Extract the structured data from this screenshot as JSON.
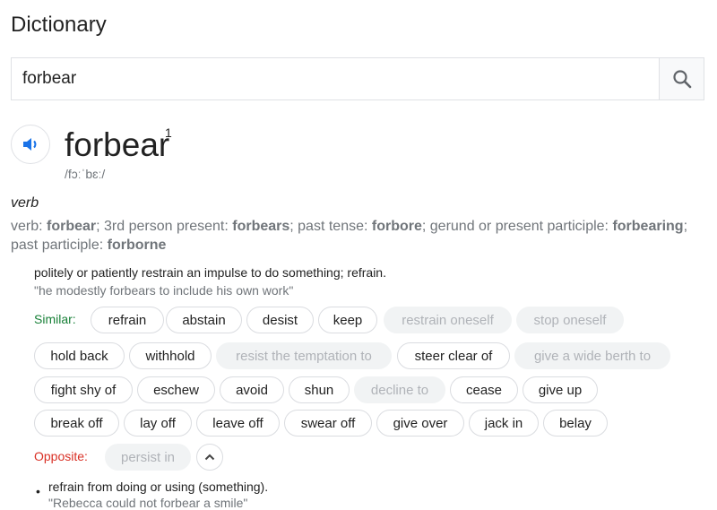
{
  "header": {
    "title": "Dictionary"
  },
  "search": {
    "value": "forbear",
    "placeholder": ""
  },
  "entry": {
    "word": "forbear",
    "superscript": "1",
    "phonetic": "/fɔːˈbɛː/",
    "part_of_speech": "verb",
    "forms": {
      "verb_label": "verb: ",
      "verb": "forbear",
      "p3_label": "; 3rd person present: ",
      "p3": "forbears",
      "past_label": "; past tense: ",
      "past": "forbore",
      "gerund_label": "; gerund or present participle: ",
      "gerund": "forbearing",
      "pp_label": "; past participle: ",
      "pp": "forborne"
    },
    "sense1": {
      "definition": "politely or patiently restrain an impulse to do something; refrain.",
      "example": "\"he modestly forbears to include his own work\"",
      "similar_label": "Similar:",
      "similar": [
        {
          "text": "refrain",
          "enabled": true
        },
        {
          "text": "abstain",
          "enabled": true
        },
        {
          "text": "desist",
          "enabled": true
        },
        {
          "text": "keep",
          "enabled": true
        },
        {
          "text": "restrain oneself",
          "enabled": false
        },
        {
          "text": "stop oneself",
          "enabled": false
        },
        {
          "text": "hold back",
          "enabled": true
        },
        {
          "text": "withhold",
          "enabled": true
        },
        {
          "text": "resist the temptation to",
          "enabled": false
        },
        {
          "text": "steer clear of",
          "enabled": true
        },
        {
          "text": "give a wide berth to",
          "enabled": false
        },
        {
          "text": "fight shy of",
          "enabled": true
        },
        {
          "text": "eschew",
          "enabled": true
        },
        {
          "text": "avoid",
          "enabled": true
        },
        {
          "text": "shun",
          "enabled": true
        },
        {
          "text": "decline to",
          "enabled": false
        },
        {
          "text": "cease",
          "enabled": true
        },
        {
          "text": "give up",
          "enabled": true
        },
        {
          "text": "break off",
          "enabled": true
        },
        {
          "text": "lay off",
          "enabled": true
        },
        {
          "text": "leave off",
          "enabled": true
        },
        {
          "text": "swear off",
          "enabled": true
        },
        {
          "text": "give over",
          "enabled": true
        },
        {
          "text": "jack in",
          "enabled": true
        },
        {
          "text": "belay",
          "enabled": true
        }
      ],
      "opposite_label": "Opposite:",
      "opposite": [
        {
          "text": "persist in",
          "enabled": false
        }
      ]
    },
    "sense2": {
      "bullet": "•",
      "definition": "refrain from doing or using (something).",
      "example": "\"Rebecca could not forbear a smile\""
    }
  },
  "colors": {
    "similar_label": "#188038",
    "opposite_label": "#d93025",
    "speaker": "#1a73e8"
  }
}
